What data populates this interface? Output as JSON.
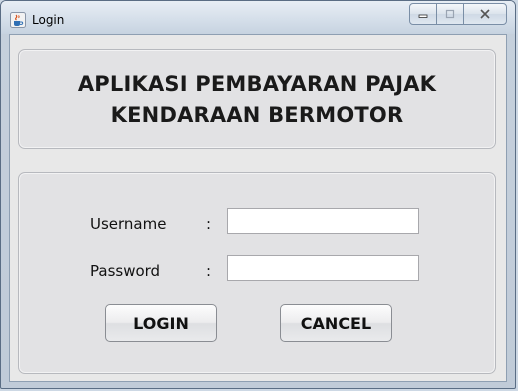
{
  "window": {
    "title": "Login"
  },
  "header": {
    "line1": "APLIKASI PEMBAYARAN PAJAK",
    "line2": "KENDARAAN BERMOTOR"
  },
  "form": {
    "username_label": "Username",
    "password_label": "Password",
    "separator": ":",
    "username_value": "",
    "password_value": ""
  },
  "buttons": {
    "login": "LOGIN",
    "cancel": "CANCEL"
  },
  "icons": {
    "app": "java-cup-icon",
    "minimize": "minimize-icon",
    "maximize": "maximize-icon",
    "close": "close-icon"
  }
}
